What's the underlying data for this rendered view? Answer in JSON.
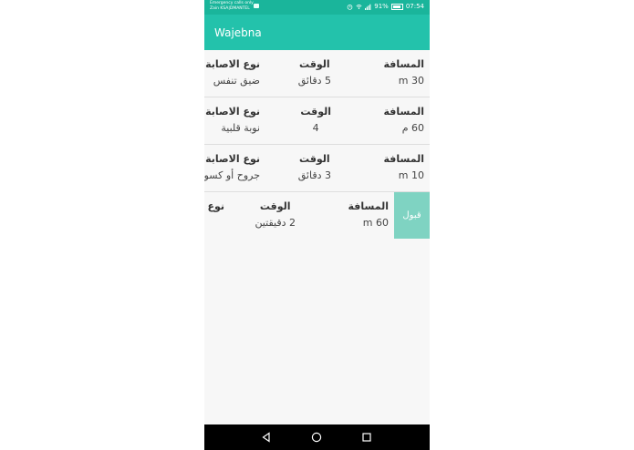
{
  "status_bar": {
    "carrier_line1": "Emergency calls only",
    "carrier_line2": "Zain KSA|DMANTEL",
    "battery": "91%",
    "time": "07:54"
  },
  "app_bar": {
    "title": "Wajebna"
  },
  "headers": {
    "distance": "المسافة",
    "time": "الوقت",
    "injury": "نوع الاصابة"
  },
  "rows": [
    {
      "distance": "30 m",
      "time": "5 دقائق",
      "injury": "ضيق تنفس"
    },
    {
      "distance": "60 م",
      "time": "4",
      "injury": "نوبة قلبية"
    },
    {
      "distance": "10 m",
      "time": "3 دقائق",
      "injury": "جروح أو كسور"
    },
    {
      "distance": "60 m",
      "time": "2 دقيقتين",
      "injury": ""
    }
  ],
  "accept_label": "قبول",
  "colors": {
    "primary": "#23c2ab",
    "status": "#1ab59b",
    "accept": "#7fd3c2"
  }
}
